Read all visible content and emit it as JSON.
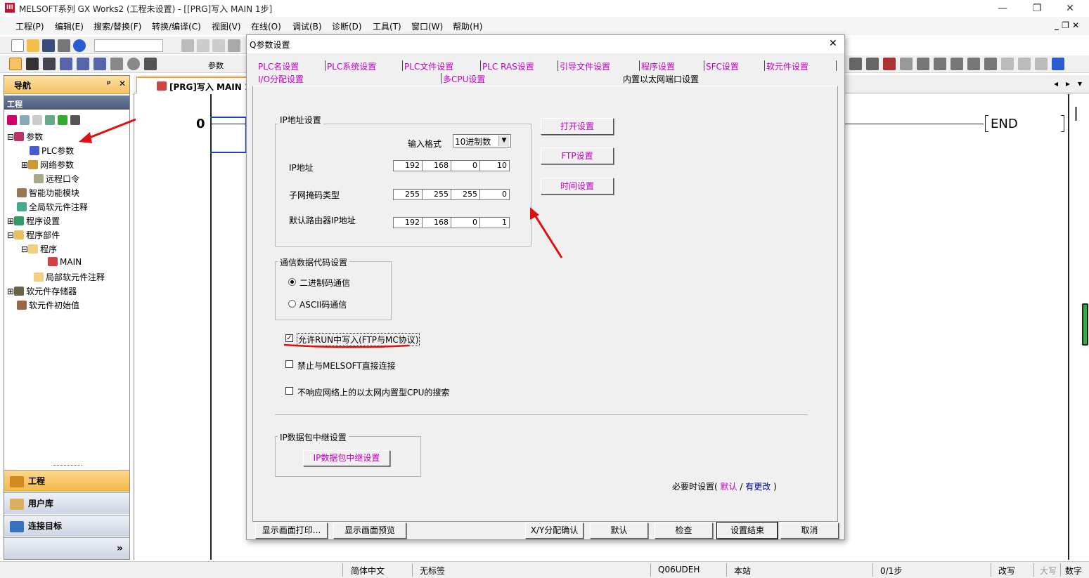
{
  "window": {
    "title": "MELSOFT系列 GX Works2 (工程未设置) - [[PRG]写入 MAIN 1步]",
    "minimize": "—",
    "restore": "❐",
    "close": "✕"
  },
  "menu": [
    "工程(P)",
    "编辑(E)",
    "搜索/替换(F)",
    "转换/编译(C)",
    "视图(V)",
    "在线(O)",
    "调试(B)",
    "诊断(D)",
    "工具(T)",
    "窗口(W)",
    "帮助(H)"
  ],
  "mdi_controls": "_ ❐ ✕",
  "toolbar": {
    "label": "参数"
  },
  "nav": {
    "title": "导航",
    "pin": "ᵖ",
    "close": "✕",
    "section": "工程",
    "tree": [
      {
        "label": "参数",
        "indent": 0,
        "expander": "⊟"
      },
      {
        "label": "PLC参数",
        "indent": 1,
        "expander": ""
      },
      {
        "label": "网络参数",
        "indent": 1,
        "expander": "⊞"
      },
      {
        "label": "远程口令",
        "indent": 1,
        "expander": ""
      },
      {
        "label": "智能功能模块",
        "indent": 0,
        "expander": ""
      },
      {
        "label": "全局软元件注释",
        "indent": 0,
        "expander": ""
      },
      {
        "label": "程序设置",
        "indent": 0,
        "expander": "⊞"
      },
      {
        "label": "程序部件",
        "indent": 0,
        "expander": "⊟"
      },
      {
        "label": "程序",
        "indent": 1,
        "expander": "⊟"
      },
      {
        "label": "MAIN",
        "indent": 2,
        "expander": ""
      },
      {
        "label": "局部软元件注释",
        "indent": 1,
        "expander": ""
      },
      {
        "label": "软元件存储器",
        "indent": 0,
        "expander": "⊞"
      },
      {
        "label": "软元件初始值",
        "indent": 0,
        "expander": ""
      }
    ],
    "buttons": [
      "工程",
      "用户库",
      "连接目标"
    ],
    "more": "»"
  },
  "editor": {
    "tab": "[PRG]写入 MAIN 1",
    "step": "0",
    "end": "END",
    "scroll_left": "◂",
    "scroll_right": "▸",
    "scroll_menu": "▾"
  },
  "status": {
    "lang": "简体中文",
    "label": "无标签",
    "cpu": "Q06UDEH",
    "station": "本站",
    "steps": "0/1步",
    "mode": "改写",
    "caps": "大写",
    "num": "数字"
  },
  "dialog": {
    "title": "Q参数设置",
    "close": "✕",
    "tabs_row1": [
      "PLC名设置",
      "PLC系统设置",
      "PLC文件设置",
      "PLC RAS设置",
      "引导文件设置",
      "程序设置",
      "SFC设置",
      "软元件设置"
    ],
    "tabs_row2": [
      "I/O分配设置",
      "多CPU设置",
      "内置以太网端口设置"
    ],
    "ip_group": {
      "title": "IP地址设置",
      "format_label": "输入格式",
      "format_value": "10进制数",
      "ip_label": "IP地址",
      "ip": [
        "192",
        "168",
        "0",
        "10"
      ],
      "mask_label": "子网掩码类型",
      "mask": [
        "255",
        "255",
        "255",
        "0"
      ],
      "gw_label": "默认路由器IP地址",
      "gw": [
        "192",
        "168",
        "0",
        "1"
      ]
    },
    "side_buttons": [
      "打开设置",
      "FTP设置",
      "时间设置"
    ],
    "comm_group": {
      "title": "通信数据代码设置",
      "options": [
        "二进制码通信",
        "ASCII码通信"
      ],
      "selected": 0
    },
    "checkboxes": [
      {
        "label": "允许RUN中写入(FTP与MC协议)",
        "checked": true
      },
      {
        "label": "禁止与MELSOFT直接连接",
        "checked": false
      },
      {
        "label": "不响应网络上的以太网内置型CPU的搜索",
        "checked": false
      }
    ],
    "relay_group": {
      "title": "IP数据包中继设置",
      "button": "IP数据包中继设置"
    },
    "footer": {
      "prefix": "必要时设置(",
      "default": "默认",
      "slash": "/",
      "changed": "有更改",
      "suffix": ")"
    },
    "bottom_buttons": [
      "显示画面打印...",
      "显示画面预览",
      "X/Y分配确认",
      "默认",
      "检查",
      "设置结束",
      "取消"
    ]
  },
  "colors": {
    "accent_orange": "#f6c363",
    "magenta": "#c000c0",
    "annotation_red": "#e01010"
  }
}
